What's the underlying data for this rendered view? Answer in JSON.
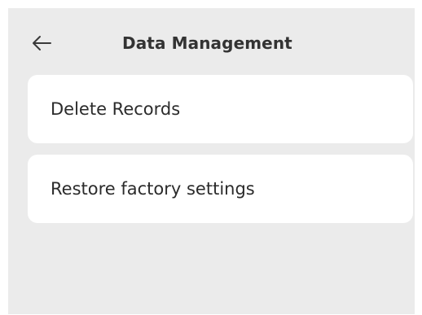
{
  "header": {
    "title": "Data Management",
    "back_icon": "arrow-left-icon"
  },
  "menu": {
    "items": [
      {
        "label": "Delete Records"
      },
      {
        "label": "Restore factory settings"
      }
    ]
  },
  "colors": {
    "background": "#ebebeb",
    "card": "#ffffff",
    "text": "#2b2b2b"
  }
}
